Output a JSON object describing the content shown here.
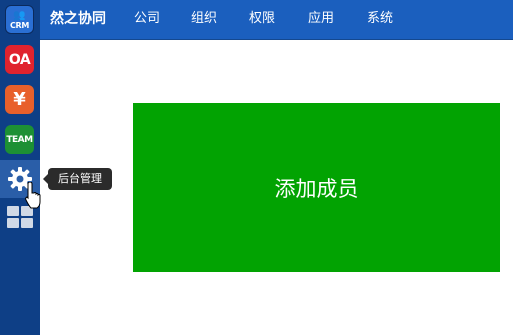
{
  "sidebar": {
    "apps": [
      {
        "id": "crm",
        "label": "CRM",
        "icon": "crm-icon",
        "color": "#2a6fd4"
      },
      {
        "id": "oa",
        "label": "OA",
        "icon": "oa-icon",
        "color": "#e0232e"
      },
      {
        "id": "finance",
        "label": "¥",
        "icon": "yen-icon",
        "color": "#e8602b"
      },
      {
        "id": "team",
        "label": "TEAM",
        "icon": "team-icon",
        "color": "#1d9034"
      },
      {
        "id": "admin",
        "icon": "gear-icon",
        "active": true
      },
      {
        "id": "apps",
        "icon": "grid-icon"
      }
    ],
    "tooltip": "后台管理"
  },
  "topbar": {
    "brand": "然之协同",
    "nav": [
      "公司",
      "组织",
      "权限",
      "应用",
      "系统"
    ],
    "color": "#1b5fbe"
  },
  "main": {
    "add_member_label": "添加成员",
    "add_member_color": "#02a302"
  }
}
